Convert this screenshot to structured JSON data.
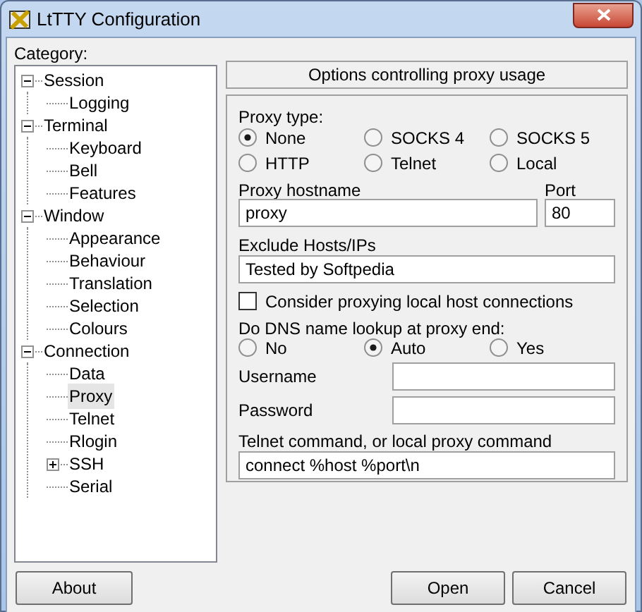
{
  "window": {
    "title": "LtTTY Configuration"
  },
  "category_label": "Category:",
  "tree": [
    {
      "label": "Session",
      "kind": "folder",
      "expanded": true,
      "selected": false,
      "children": [
        {
          "label": "Logging",
          "kind": "leaf",
          "selected": false
        }
      ]
    },
    {
      "label": "Terminal",
      "kind": "folder",
      "expanded": true,
      "selected": false,
      "children": [
        {
          "label": "Keyboard",
          "kind": "leaf",
          "selected": false
        },
        {
          "label": "Bell",
          "kind": "leaf",
          "selected": false
        },
        {
          "label": "Features",
          "kind": "leaf",
          "selected": false
        }
      ]
    },
    {
      "label": "Window",
      "kind": "folder",
      "expanded": true,
      "selected": false,
      "children": [
        {
          "label": "Appearance",
          "kind": "leaf",
          "selected": false
        },
        {
          "label": "Behaviour",
          "kind": "leaf",
          "selected": false
        },
        {
          "label": "Translation",
          "kind": "leaf",
          "selected": false
        },
        {
          "label": "Selection",
          "kind": "leaf",
          "selected": false
        },
        {
          "label": "Colours",
          "kind": "leaf",
          "selected": false
        }
      ]
    },
    {
      "label": "Connection",
      "kind": "folder",
      "expanded": true,
      "selected": false,
      "children": [
        {
          "label": "Data",
          "kind": "leaf",
          "selected": false
        },
        {
          "label": "Proxy",
          "kind": "leaf",
          "selected": true
        },
        {
          "label": "Telnet",
          "kind": "leaf",
          "selected": false
        },
        {
          "label": "Rlogin",
          "kind": "leaf",
          "selected": false
        },
        {
          "label": "SSH",
          "kind": "folder",
          "expanded": false,
          "selected": false
        },
        {
          "label": "Serial",
          "kind": "leaf",
          "selected": false
        }
      ]
    }
  ],
  "header": "Options controlling proxy usage",
  "proxy_type": {
    "label": "Proxy type:",
    "options": [
      {
        "label": "None",
        "selected": true
      },
      {
        "label": "SOCKS 4",
        "selected": false
      },
      {
        "label": "SOCKS 5",
        "selected": false
      },
      {
        "label": "HTTP",
        "selected": false
      },
      {
        "label": "Telnet",
        "selected": false
      },
      {
        "label": "Local",
        "selected": false
      }
    ]
  },
  "hostname": {
    "label": "Proxy hostname",
    "value": "proxy"
  },
  "port": {
    "label": "Port",
    "value": "80"
  },
  "exclude": {
    "label": "Exclude Hosts/IPs",
    "value": "Tested by Softpedia"
  },
  "local_hosts": {
    "label": "Consider proxying local host connections",
    "checked": false
  },
  "dns": {
    "label": "Do DNS name lookup at proxy end:",
    "options": [
      {
        "label": "No",
        "selected": false
      },
      {
        "label": "Auto",
        "selected": true
      },
      {
        "label": "Yes",
        "selected": false
      }
    ]
  },
  "username": {
    "label": "Username"
  },
  "password": {
    "label": "Password"
  },
  "telnet_command": {
    "label": "Telnet command, or local proxy command",
    "value": "connect %host %port\\n"
  },
  "buttons": [
    {
      "label": "About"
    },
    {
      "label": "Open"
    },
    {
      "label": "Cancel"
    }
  ]
}
